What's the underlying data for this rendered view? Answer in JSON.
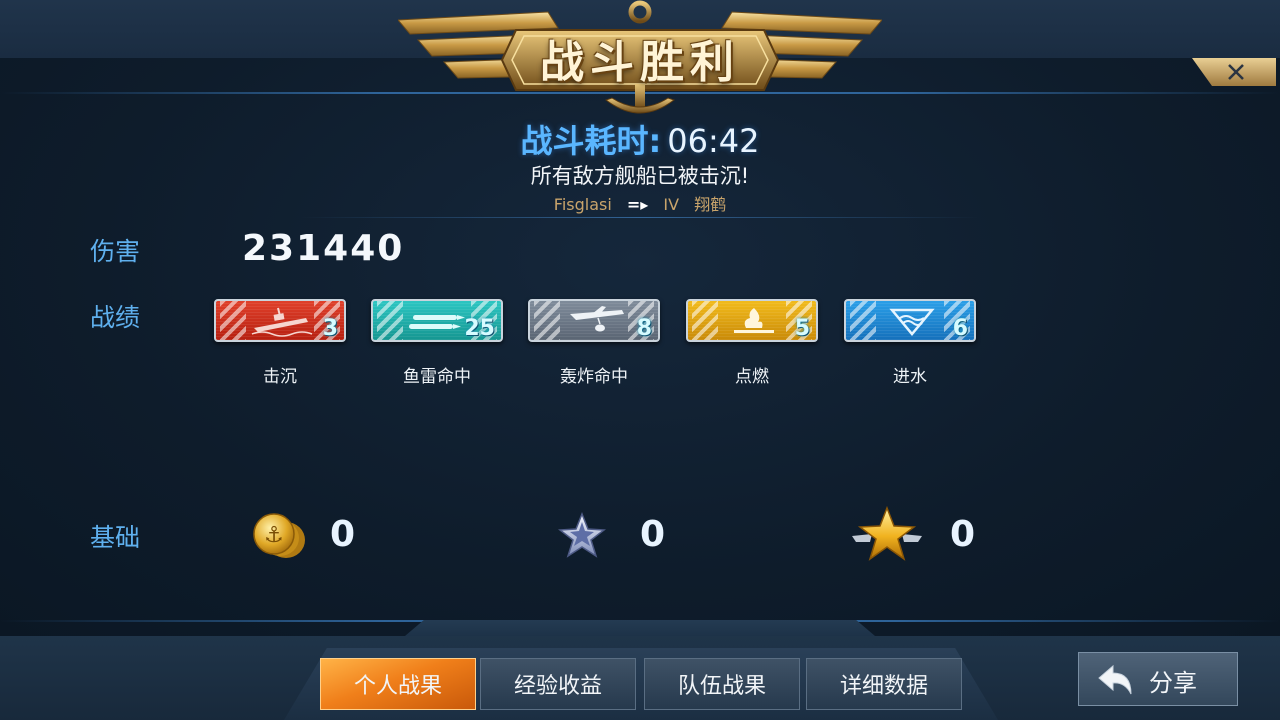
{
  "header": {
    "title": "战斗胜利",
    "close_icon": "close-icon"
  },
  "summary": {
    "duration_label": "战斗耗时:",
    "duration_value": "06:42",
    "result_message": "所有敌方舰船已被击沉!",
    "player_name": "Fisglasi",
    "ship_tier": "IV",
    "ship_name": "翔鹤"
  },
  "damage": {
    "label": "伤害",
    "value": "231440"
  },
  "achievements": {
    "label": "战绩",
    "items": [
      {
        "label": "击沉",
        "count": "3",
        "icon": "sinking-ship-icon",
        "color": "#d12f1c"
      },
      {
        "label": "鱼雷命中",
        "count": "25",
        "icon": "torpedo-icon",
        "color": "#22b3af"
      },
      {
        "label": "轰炸命中",
        "count": "8",
        "icon": "bomber-icon",
        "color": "#6d7a89"
      },
      {
        "label": "点燃",
        "count": "5",
        "icon": "fire-icon",
        "color": "#e4a512"
      },
      {
        "label": "进水",
        "count": "6",
        "icon": "flooding-icon",
        "color": "#1f88d6"
      }
    ]
  },
  "basics": {
    "label": "基础",
    "items": [
      {
        "icon": "gold-coin-icon",
        "value": "0"
      },
      {
        "icon": "silver-star-icon",
        "value": "0"
      },
      {
        "icon": "gold-star-icon",
        "value": "0"
      }
    ]
  },
  "tabs": [
    {
      "label": "个人战果",
      "active": true
    },
    {
      "label": "经验收益",
      "active": false
    },
    {
      "label": "队伍战果",
      "active": false
    },
    {
      "label": "详细数据",
      "active": false
    }
  ],
  "share": {
    "label": "分享",
    "icon": "return-arrow-icon"
  },
  "colors": {
    "accent_blue": "#5ab6ff",
    "active_tab": "#f07f1a",
    "background": "#0e1c2b",
    "gold": "#c9a46b"
  }
}
